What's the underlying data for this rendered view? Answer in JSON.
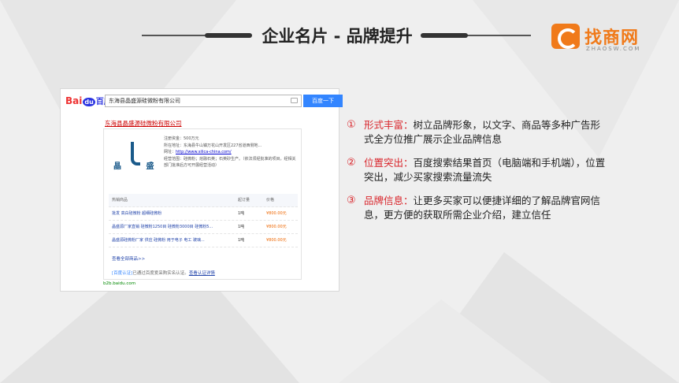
{
  "slide_title": "企业名片 - 品牌提升",
  "logo": {
    "text": "找商网",
    "sub": "ZHAOSW.COM"
  },
  "baidu": {
    "logo_text": "Bai",
    "logo_du": "du",
    "logo_cn": "百度",
    "search_value": "东海县晶盛源硅微粉有限公司",
    "search_button": "百度一下",
    "result_title": "东海县晶盛源硅微粉有限公司",
    "company_logo_text": "晶 盛",
    "info_lines": [
      "注册资金：500万元",
      "所在地址：东海县牛山镇万花山开发区227省道西侧地...",
      "经营范围：硅微粉；熔融石英；石英砂生产。（依法须经批准的项目，经相关部门批准后方可开展经营活动）"
    ],
    "website_label": "网址：",
    "website_url": "http://www.silica-china.com/",
    "table_headers": [
      "热销商品",
      "起订量",
      "价格"
    ],
    "products": [
      {
        "name": "批发 高白硅微粉 超细硅微粉",
        "qty": "1吨",
        "price": "¥800.00元"
      },
      {
        "name": "晶盛源厂家直销 硅微粉1250目 硅微粉3000目 硅微粉5...",
        "qty": "1吨",
        "price": "¥800.00元"
      },
      {
        "name": "晶盛源硅微粉厂家 供应 硅微粉 用于电子 电工 玻璃...",
        "qty": "1吨",
        "price": "¥800.00元"
      }
    ],
    "more_link": "查看全部商品>>",
    "verify_tag": "[百度认证]",
    "verify_text": "已通过百度爱采购实名认证。",
    "verify_link": "查看认证详情",
    "site_url": "b2b.baidu.com"
  },
  "bullets": [
    {
      "num": "①",
      "key": "形式丰富：",
      "text": "树立品牌形象，以文字、商品等多种广告形式全方位推广展示企业品牌信息"
    },
    {
      "num": "②",
      "key": "位置突出：",
      "text": "百度搜索结果首页（电脑端和手机端），位置突出，减少买家搜索流量流失"
    },
    {
      "num": "③",
      "key": "品牌信息：",
      "text": "让更多买家可以便捷详细的了解品牌官网信息，更方便的获取所需企业介绍，建立信任"
    }
  ],
  "colors": {
    "accent_red": "#d9262c",
    "brand_orange": "#f07a1a",
    "baidu_blue": "#3385ff"
  }
}
